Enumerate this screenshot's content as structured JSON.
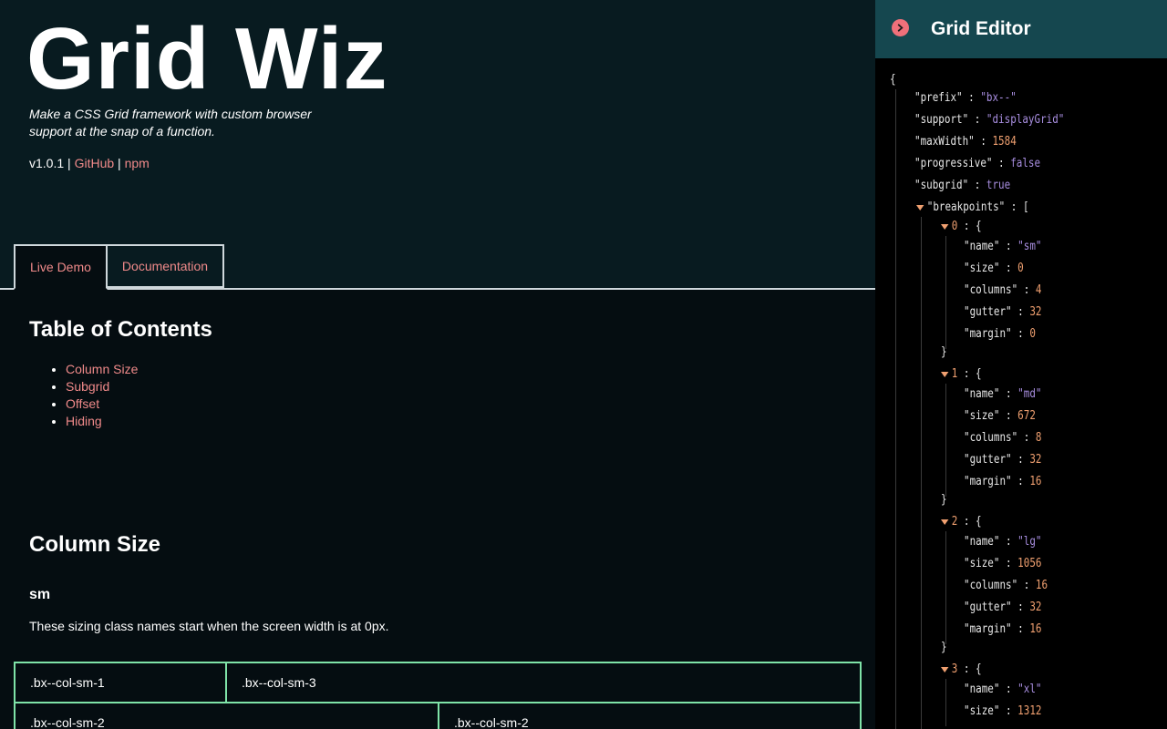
{
  "hero": {
    "title": "Grid Wiz",
    "tagline": "Make a CSS Grid framework with custom browser support at the snap of a function.",
    "version": "v1.0.1",
    "sep1": "|",
    "sep2": "|",
    "github_link": "GitHub",
    "npm_link": "npm"
  },
  "tabs": [
    {
      "label": "Live Demo",
      "active": true
    },
    {
      "label": "Documentation",
      "active": false
    }
  ],
  "toc": {
    "title": "Table of Contents",
    "items": [
      "Column Size",
      "Subgrid",
      "Offset",
      "Hiding"
    ]
  },
  "column_size": {
    "title": "Column Size",
    "sm_title": "sm",
    "sm_desc": "These sizing class names start when the screen width is at 0px.",
    "rows": [
      [
        "\u0000.bx--col-sm-1",
        ".bx--col-sm-3"
      ],
      [
        ".bx--col-sm-2",
        ".bx--col-sm-2"
      ]
    ]
  },
  "editor": {
    "title": "Grid Editor",
    "open_brace": "{",
    "fields": [
      {
        "key": "\"prefix\"",
        "value": "\"bx--\"",
        "type": "s"
      },
      {
        "key": "\"support\"",
        "value": "\"displayGrid\"",
        "type": "s"
      },
      {
        "key": "\"maxWidth\"",
        "value": "1584",
        "type": "n"
      },
      {
        "key": "\"progressive\"",
        "value": "false",
        "type": "b"
      },
      {
        "key": "\"subgrid\"",
        "value": "true",
        "type": "b"
      }
    ],
    "breakpoints_key": "\"breakpoints\"",
    "breakpoints_open": "[",
    "breakpoints": [
      {
        "index": "0",
        "name": "\"sm\"",
        "size": "0",
        "columns": "4",
        "gutter": "32",
        "margin": "0"
      },
      {
        "index": "1",
        "name": "\"md\"",
        "size": "672",
        "columns": "8",
        "gutter": "32",
        "margin": "16"
      },
      {
        "index": "2",
        "name": "\"lg\"",
        "size": "1056",
        "columns": "16",
        "gutter": "32",
        "margin": "16"
      },
      {
        "index": "3",
        "name": "\"xl\"",
        "size": "1312"
      }
    ],
    "colors": {
      "key": "#e8e8e8",
      "string": "#a88ee0",
      "number": "#f0a070",
      "arrow": "#f0a070",
      "close": "#f0707a",
      "header": "#15474f"
    }
  }
}
